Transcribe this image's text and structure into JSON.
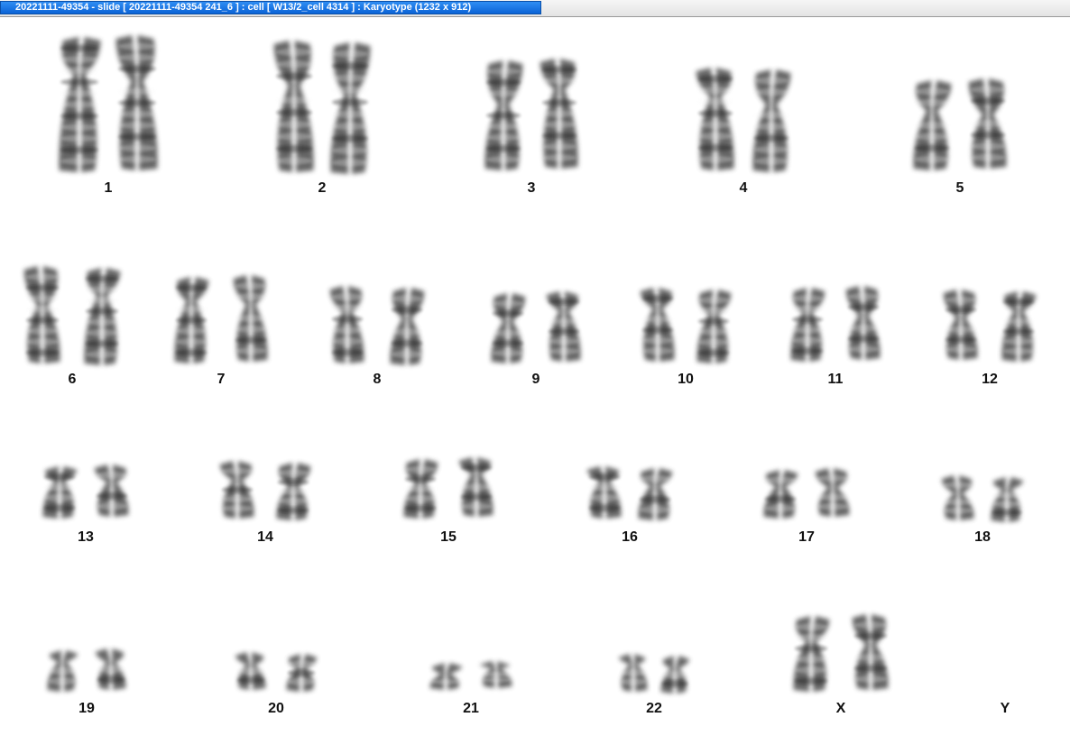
{
  "window": {
    "title": "20221111-49354 - slide [ 20221111-49354 241_6 ] : cell [ W13/2_cell 4314 ] : Karyotype  (1232 x 912)"
  },
  "karyotype": {
    "pairs": [
      {
        "label": "1",
        "chromosome_count": 2
      },
      {
        "label": "2",
        "chromosome_count": 2
      },
      {
        "label": "3",
        "chromosome_count": 2
      },
      {
        "label": "4",
        "chromosome_count": 2
      },
      {
        "label": "5",
        "chromosome_count": 2
      },
      {
        "label": "6",
        "chromosome_count": 2
      },
      {
        "label": "7",
        "chromosome_count": 2
      },
      {
        "label": "8",
        "chromosome_count": 2
      },
      {
        "label": "9",
        "chromosome_count": 2
      },
      {
        "label": "10",
        "chromosome_count": 2
      },
      {
        "label": "11",
        "chromosome_count": 2
      },
      {
        "label": "12",
        "chromosome_count": 2
      },
      {
        "label": "13",
        "chromosome_count": 2
      },
      {
        "label": "14",
        "chromosome_count": 2
      },
      {
        "label": "15",
        "chromosome_count": 2
      },
      {
        "label": "16",
        "chromosome_count": 2
      },
      {
        "label": "17",
        "chromosome_count": 2
      },
      {
        "label": "18",
        "chromosome_count": 2
      },
      {
        "label": "19",
        "chromosome_count": 2
      },
      {
        "label": "20",
        "chromosome_count": 2
      },
      {
        "label": "21",
        "chromosome_count": 2
      },
      {
        "label": "22",
        "chromosome_count": 2
      },
      {
        "label": "X",
        "chromosome_count": 2
      },
      {
        "label": "Y",
        "chromosome_count": 0
      }
    ]
  },
  "colors": {
    "title_tab": "#1a78e8",
    "chromosome": "#3a3a3a",
    "label": "#111111",
    "background": "#ffffff"
  }
}
